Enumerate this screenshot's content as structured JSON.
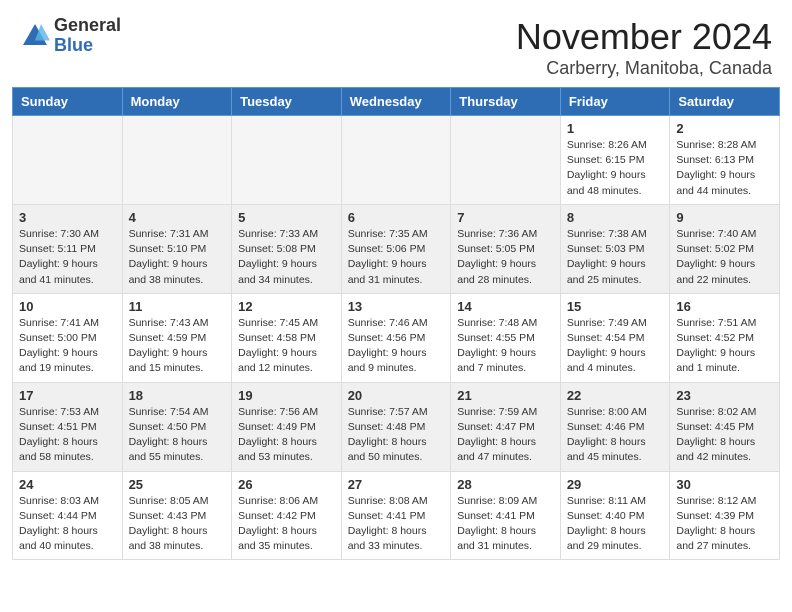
{
  "header": {
    "logo_general": "General",
    "logo_blue": "Blue",
    "month": "November 2024",
    "location": "Carberry, Manitoba, Canada"
  },
  "days_of_week": [
    "Sunday",
    "Monday",
    "Tuesday",
    "Wednesday",
    "Thursday",
    "Friday",
    "Saturday"
  ],
  "weeks": [
    [
      {
        "day": "",
        "info": ""
      },
      {
        "day": "",
        "info": ""
      },
      {
        "day": "",
        "info": ""
      },
      {
        "day": "",
        "info": ""
      },
      {
        "day": "",
        "info": ""
      },
      {
        "day": "1",
        "info": "Sunrise: 8:26 AM\nSunset: 6:15 PM\nDaylight: 9 hours\nand 48 minutes."
      },
      {
        "day": "2",
        "info": "Sunrise: 8:28 AM\nSunset: 6:13 PM\nDaylight: 9 hours\nand 44 minutes."
      }
    ],
    [
      {
        "day": "3",
        "info": "Sunrise: 7:30 AM\nSunset: 5:11 PM\nDaylight: 9 hours\nand 41 minutes."
      },
      {
        "day": "4",
        "info": "Sunrise: 7:31 AM\nSunset: 5:10 PM\nDaylight: 9 hours\nand 38 minutes."
      },
      {
        "day": "5",
        "info": "Sunrise: 7:33 AM\nSunset: 5:08 PM\nDaylight: 9 hours\nand 34 minutes."
      },
      {
        "day": "6",
        "info": "Sunrise: 7:35 AM\nSunset: 5:06 PM\nDaylight: 9 hours\nand 31 minutes."
      },
      {
        "day": "7",
        "info": "Sunrise: 7:36 AM\nSunset: 5:05 PM\nDaylight: 9 hours\nand 28 minutes."
      },
      {
        "day": "8",
        "info": "Sunrise: 7:38 AM\nSunset: 5:03 PM\nDaylight: 9 hours\nand 25 minutes."
      },
      {
        "day": "9",
        "info": "Sunrise: 7:40 AM\nSunset: 5:02 PM\nDaylight: 9 hours\nand 22 minutes."
      }
    ],
    [
      {
        "day": "10",
        "info": "Sunrise: 7:41 AM\nSunset: 5:00 PM\nDaylight: 9 hours\nand 19 minutes."
      },
      {
        "day": "11",
        "info": "Sunrise: 7:43 AM\nSunset: 4:59 PM\nDaylight: 9 hours\nand 15 minutes."
      },
      {
        "day": "12",
        "info": "Sunrise: 7:45 AM\nSunset: 4:58 PM\nDaylight: 9 hours\nand 12 minutes."
      },
      {
        "day": "13",
        "info": "Sunrise: 7:46 AM\nSunset: 4:56 PM\nDaylight: 9 hours\nand 9 minutes."
      },
      {
        "day": "14",
        "info": "Sunrise: 7:48 AM\nSunset: 4:55 PM\nDaylight: 9 hours\nand 7 minutes."
      },
      {
        "day": "15",
        "info": "Sunrise: 7:49 AM\nSunset: 4:54 PM\nDaylight: 9 hours\nand 4 minutes."
      },
      {
        "day": "16",
        "info": "Sunrise: 7:51 AM\nSunset: 4:52 PM\nDaylight: 9 hours\nand 1 minute."
      }
    ],
    [
      {
        "day": "17",
        "info": "Sunrise: 7:53 AM\nSunset: 4:51 PM\nDaylight: 8 hours\nand 58 minutes."
      },
      {
        "day": "18",
        "info": "Sunrise: 7:54 AM\nSunset: 4:50 PM\nDaylight: 8 hours\nand 55 minutes."
      },
      {
        "day": "19",
        "info": "Sunrise: 7:56 AM\nSunset: 4:49 PM\nDaylight: 8 hours\nand 53 minutes."
      },
      {
        "day": "20",
        "info": "Sunrise: 7:57 AM\nSunset: 4:48 PM\nDaylight: 8 hours\nand 50 minutes."
      },
      {
        "day": "21",
        "info": "Sunrise: 7:59 AM\nSunset: 4:47 PM\nDaylight: 8 hours\nand 47 minutes."
      },
      {
        "day": "22",
        "info": "Sunrise: 8:00 AM\nSunset: 4:46 PM\nDaylight: 8 hours\nand 45 minutes."
      },
      {
        "day": "23",
        "info": "Sunrise: 8:02 AM\nSunset: 4:45 PM\nDaylight: 8 hours\nand 42 minutes."
      }
    ],
    [
      {
        "day": "24",
        "info": "Sunrise: 8:03 AM\nSunset: 4:44 PM\nDaylight: 8 hours\nand 40 minutes."
      },
      {
        "day": "25",
        "info": "Sunrise: 8:05 AM\nSunset: 4:43 PM\nDaylight: 8 hours\nand 38 minutes."
      },
      {
        "day": "26",
        "info": "Sunrise: 8:06 AM\nSunset: 4:42 PM\nDaylight: 8 hours\nand 35 minutes."
      },
      {
        "day": "27",
        "info": "Sunrise: 8:08 AM\nSunset: 4:41 PM\nDaylight: 8 hours\nand 33 minutes."
      },
      {
        "day": "28",
        "info": "Sunrise: 8:09 AM\nSunset: 4:41 PM\nDaylight: 8 hours\nand 31 minutes."
      },
      {
        "day": "29",
        "info": "Sunrise: 8:11 AM\nSunset: 4:40 PM\nDaylight: 8 hours\nand 29 minutes."
      },
      {
        "day": "30",
        "info": "Sunrise: 8:12 AM\nSunset: 4:39 PM\nDaylight: 8 hours\nand 27 minutes."
      }
    ]
  ]
}
